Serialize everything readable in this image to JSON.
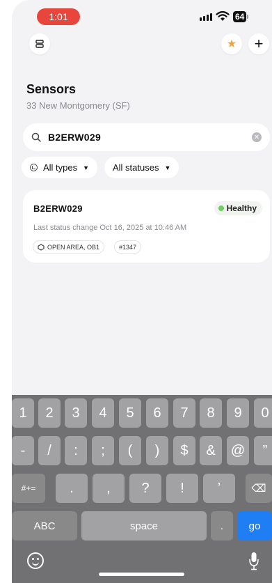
{
  "status_bar": {
    "time": "1:01",
    "battery": "64"
  },
  "header": {
    "menu_icon": "server-icon",
    "star_icon": "star-icon",
    "add_icon": "plus-icon",
    "star_color": "#f0a23b"
  },
  "page": {
    "title": "Sensors",
    "subtitle": "33 New Montgomery (SF)"
  },
  "search": {
    "value": "B2ERW029",
    "clear_icon": "clear-icon"
  },
  "filters": [
    {
      "label": "All types",
      "caret": "▼"
    },
    {
      "label": "All statuses",
      "caret": "▼"
    }
  ],
  "results": [
    {
      "name": "B2ERW029",
      "status": "Healthy",
      "status_color": "#6ecf61",
      "meta": "Last status change Oct 16, 2025 at 10:46 AM",
      "location_tag": "OPEN AREA, OB1",
      "number_tag": "#1347"
    }
  ],
  "keyboard": {
    "row1": [
      "1",
      "2",
      "3",
      "4",
      "5",
      "6",
      "7",
      "8",
      "9",
      "0"
    ],
    "row2": [
      "-",
      "/",
      ":",
      ";",
      "(",
      ")",
      "$",
      "&",
      "@",
      "”"
    ],
    "row3": [
      "#+=",
      ".",
      ",",
      "?",
      "!",
      "’",
      "⌫"
    ],
    "row4": [
      "ABC",
      "space",
      ".",
      "go"
    ],
    "accent": "#1f7ef4"
  }
}
